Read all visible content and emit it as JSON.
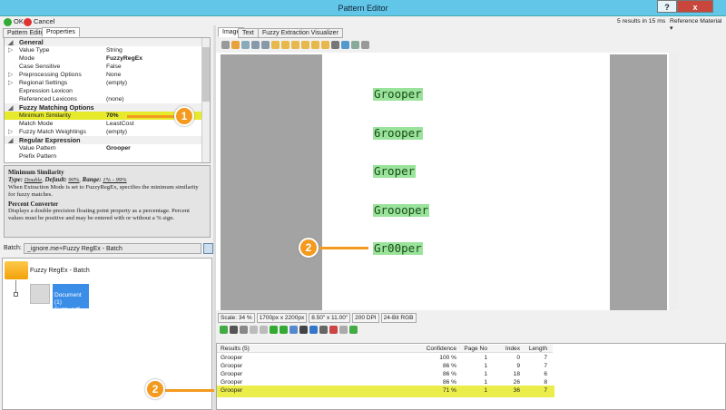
{
  "window": {
    "title": "Pattern Editor",
    "help": "?",
    "close": "x"
  },
  "toolbar": {
    "ok": "OK",
    "cancel": "Cancel",
    "status": "5 results in 15 ms",
    "reference": "Reference Material"
  },
  "left_tabs": [
    "Pattern Editor",
    "Properties"
  ],
  "properties": [
    {
      "type": "cat",
      "key": "General"
    },
    {
      "key": "Value Type",
      "value": "String",
      "exp": true
    },
    {
      "key": "Mode",
      "value": "FuzzyRegEx",
      "bold": true
    },
    {
      "key": "Case Sensitive",
      "value": "False"
    },
    {
      "key": "Preprocessing Options",
      "value": "None",
      "exp": true
    },
    {
      "key": "Regional Settings",
      "value": "(empty)",
      "exp": true
    },
    {
      "key": "Expression Lexicon",
      "value": ""
    },
    {
      "key": "Referenced Lexicons",
      "value": "(none)"
    },
    {
      "type": "cat",
      "key": "Fuzzy Matching Options"
    },
    {
      "key": "Minimum Similarity",
      "value": "70%",
      "bold": true,
      "highlight": true
    },
    {
      "key": "Match Mode",
      "value": "LeastCost"
    },
    {
      "key": "Fuzzy Match Weightings",
      "value": "(empty)",
      "exp": true
    },
    {
      "type": "cat",
      "key": "Regular Expression"
    },
    {
      "key": "Value Pattern",
      "value": "Grooper",
      "bold": true
    },
    {
      "key": "Prefix Pattern",
      "value": ""
    }
  ],
  "help": {
    "title": "Minimum Similarity",
    "type_label": "Type:",
    "type": "Double",
    "default_label": "Default:",
    "default": "90%",
    "range_label": "Range:",
    "range": "1% - 99%",
    "desc": "When Extraction Mode is set to FuzzyRegEx, specifies the minimum similarity for fuzzy matches.",
    "conv_title": "Percent Converter",
    "conv_desc": "Displays a double-precision floating point property as a percentage. Percent values must be positive and may be entered with or without a % sign."
  },
  "batch": {
    "label": "Batch:",
    "value": "_ignore.me+Fuzzy RegEx - Batch"
  },
  "tree": {
    "root": "Fuzzy RegEx - Batch",
    "doc": "Document (1)",
    "file": "Fuzzy.pdf"
  },
  "right_tabs": [
    "Image",
    "Text",
    "Fuzzy Extraction Visualizer"
  ],
  "document_words": [
    "Grooper",
    "6rooper",
    "Groper",
    "Groooper",
    "Gr00per"
  ],
  "status_bar": [
    "Scale: 34 %",
    "1700px x 2200px",
    "8.50\" x 11.00\"",
    "200 DPI",
    "24-Bit RGB"
  ],
  "results": {
    "headers": [
      "Results (5)",
      "Confidence",
      "Page No",
      "Index",
      "Length"
    ],
    "rows": [
      [
        "Grooper",
        "100 %",
        "1",
        "0",
        "7"
      ],
      [
        "Grooper",
        "86 %",
        "1",
        "9",
        "7"
      ],
      [
        "Grooper",
        "86 %",
        "1",
        "18",
        "6"
      ],
      [
        "Grooper",
        "86 %",
        "1",
        "26",
        "8"
      ],
      [
        "Grooper",
        "71 %",
        "1",
        "36",
        "7"
      ]
    ]
  },
  "callouts": [
    "1",
    "2",
    "2"
  ],
  "colors": {
    "titlebar": "#62c6e8",
    "highlight": "#e6ea2a",
    "callout": "#f39a1f",
    "match": "#9ae39a"
  }
}
